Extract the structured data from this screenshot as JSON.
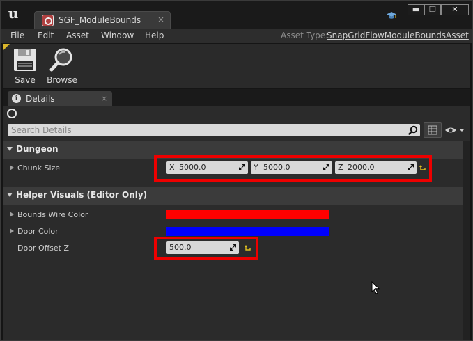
{
  "window": {
    "tab_title": "SGF_ModuleBounds",
    "tab_close": "×",
    "btn_min": "▬",
    "btn_max": "❐",
    "btn_close": "✕"
  },
  "menu": {
    "items": [
      "File",
      "Edit",
      "Asset",
      "Window",
      "Help"
    ],
    "asset_type_label": "Asset Type:",
    "asset_type_value": "SnapGridFlowModuleBoundsAsset"
  },
  "toolbar": {
    "save_label": "Save",
    "browse_label": "Browse"
  },
  "details": {
    "tab_label": "Details",
    "tab_close": "×",
    "search_placeholder": "Search Details",
    "categories": [
      {
        "label": "Dungeon",
        "properties": [
          {
            "label": "Chunk Size",
            "x_axis": "X",
            "x": "5000.0",
            "y_axis": "Y",
            "y": "5000.0",
            "z_axis": "Z",
            "z": "2000.0"
          }
        ]
      },
      {
        "label": "Helper Visuals (Editor Only)",
        "properties": [
          {
            "label": "Bounds Wire Color",
            "color": "#ff0000"
          },
          {
            "label": "Door Color",
            "color": "#0000ff"
          },
          {
            "label": "Door Offset Z",
            "value": "500.0"
          }
        ]
      }
    ]
  },
  "colors": {
    "highlight": "#ee0000",
    "reset_arrow": "#e0c020"
  }
}
